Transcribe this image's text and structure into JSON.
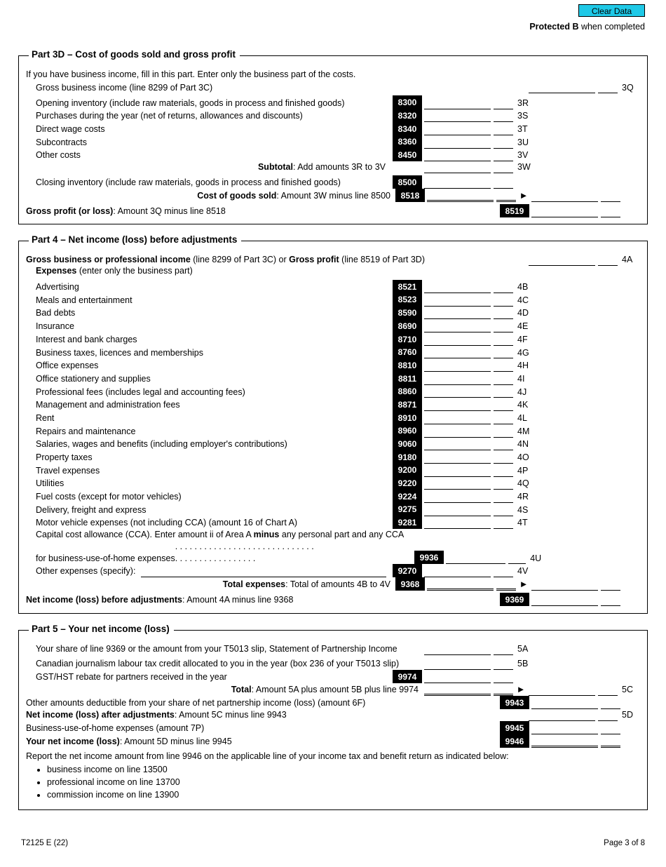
{
  "header": {
    "clear_data": "Clear Data",
    "protected_bold": "Protected B",
    "protected_rest": " when completed"
  },
  "part3d": {
    "title": "Part 3D – Cost of goods sold and gross profit",
    "intro": "If you have business income, fill in this part. Enter only the business part of the costs.",
    "gross_income": "Gross business income (line 8299 of Part 3C)",
    "letter_q": "3Q",
    "lines": [
      {
        "label": "Opening inventory (include raw materials, goods in process and finished goods)",
        "code": "8300",
        "letter": "3R"
      },
      {
        "label": "Purchases during the year (net of returns, allowances and discounts)",
        "code": "8320",
        "letter": "3S"
      },
      {
        "label": "Direct wage costs",
        "code": "8340",
        "letter": "3T"
      },
      {
        "label": "Subcontracts",
        "code": "8360",
        "letter": "3U"
      },
      {
        "label": "Other costs",
        "code": "8450",
        "letter": "3V"
      }
    ],
    "subtotal_label_bold": "Subtotal",
    "subtotal_label_rest": ": Add amounts 3R to 3V",
    "subtotal_letter": "3W",
    "closing_inv": "Closing inventory (include raw materials, goods in process and finished goods)",
    "closing_code": "8500",
    "cogs_bold": "Cost of goods sold",
    "cogs_rest": ": Amount 3W minus line 8500",
    "cogs_code": "8518",
    "gross_profit_bold": "Gross profit (or loss)",
    "gross_profit_rest": ": Amount 3Q minus line 8518",
    "gross_profit_code": "8519"
  },
  "part4": {
    "title": "Part 4 – Net income (loss) before adjustments",
    "top_bold1": "Gross business or professional income",
    "top_mid": " (line 8299 of Part 3C) or ",
    "top_bold2": "Gross profit",
    "top_end": " (line 8519 of Part 3D)",
    "top_letter": "4A",
    "expenses_bold": "Expenses",
    "expenses_rest": " (enter only the business part)",
    "lines": [
      {
        "label": "Advertising",
        "code": "8521",
        "letter": "4B"
      },
      {
        "label": "Meals and entertainment",
        "code": "8523",
        "letter": "4C"
      },
      {
        "label": "Bad debts",
        "code": "8590",
        "letter": "4D"
      },
      {
        "label": "Insurance",
        "code": "8690",
        "letter": "4E"
      },
      {
        "label": "Interest and bank charges",
        "code": "8710",
        "letter": "4F"
      },
      {
        "label": "Business taxes, licences and memberships",
        "code": "8760",
        "letter": "4G"
      },
      {
        "label": "Office expenses",
        "code": "8810",
        "letter": "4H"
      },
      {
        "label": "Office stationery and supplies",
        "code": "8811",
        "letter": "4I"
      },
      {
        "label": "Professional fees (includes legal and accounting fees)",
        "code": "8860",
        "letter": "4J"
      },
      {
        "label": "Management and administration fees",
        "code": "8871",
        "letter": "4K"
      },
      {
        "label": "Rent",
        "code": "8910",
        "letter": "4L"
      },
      {
        "label": "Repairs and maintenance",
        "code": "8960",
        "letter": "4M"
      },
      {
        "label": "Salaries, wages and benefits (including employer's contributions)",
        "code": "9060",
        "letter": "4N"
      },
      {
        "label": "Property taxes",
        "code": "9180",
        "letter": "4O"
      },
      {
        "label": "Travel expenses",
        "code": "9200",
        "letter": "4P"
      },
      {
        "label": "Utilities",
        "code": "9220",
        "letter": "4Q"
      },
      {
        "label": "Fuel costs (except for motor vehicles)",
        "code": "9224",
        "letter": "4R"
      },
      {
        "label": "Delivery, freight and express",
        "code": "9275",
        "letter": "4S"
      },
      {
        "label": "Motor vehicle expenses (not including CCA) (amount 16 of Chart A)",
        "code": "9281",
        "letter": "4T"
      }
    ],
    "cca_label_pre": "Capital cost allowance (CCA). Enter amount ii of Area A ",
    "cca_bold": "minus",
    "cca_label_post": " any personal part and any CCA for business-use-of-home expenses",
    "cca_code": "9936",
    "cca_letter": "4U",
    "other_label": "Other expenses (specify):",
    "other_code": "9270",
    "other_letter": "4V",
    "total_exp_bold": "Total expenses",
    "total_exp_rest": ": Total of amounts 4B to 4V",
    "total_exp_code": "9368",
    "net_bold": "Net income (loss) before adjustments",
    "net_rest": ": Amount 4A minus line 9368",
    "net_code": "9369"
  },
  "part5": {
    "title": "Part 5 – Your net income (loss)",
    "line5a": "Your share of line 9369 or the amount from your T5013 slip, Statement of Partnership Income",
    "letter5a": "5A",
    "line5b": "Canadian journalism labour tax credit allocated to you in the year (box 236 of your T5013 slip)",
    "letter5b": "5B",
    "line9974": "GST/HST rebate for partners received in the year",
    "code9974": "9974",
    "total_bold": "Total",
    "total_rest": ": Amount 5A plus amount 5B plus line 9974",
    "letter5c": "5C",
    "line9943": "Other amounts deductible from your share of net partnership income (loss) (amount 6F)",
    "code9943": "9943",
    "after_adj_bold": "Net income (loss) after adjustments",
    "after_adj_rest": ": Amount 5C minus line 9943",
    "letter5d": "5D",
    "line9945": "Business-use-of-home expenses (amount 7P)",
    "code9945": "9945",
    "your_net_bold": "Your net income (loss)",
    "your_net_rest": ": Amount 5D minus line 9945",
    "code9946": "9946",
    "report": "Report the net income amount from line 9946 on the applicable line of your income tax and benefit return as indicated below:",
    "bullets": [
      "business income on line 13500",
      "professional income on line 13700",
      "commission income on line 13900"
    ]
  },
  "footer": {
    "left": "T2125 E (22)",
    "right": "Page 3 of 8"
  }
}
